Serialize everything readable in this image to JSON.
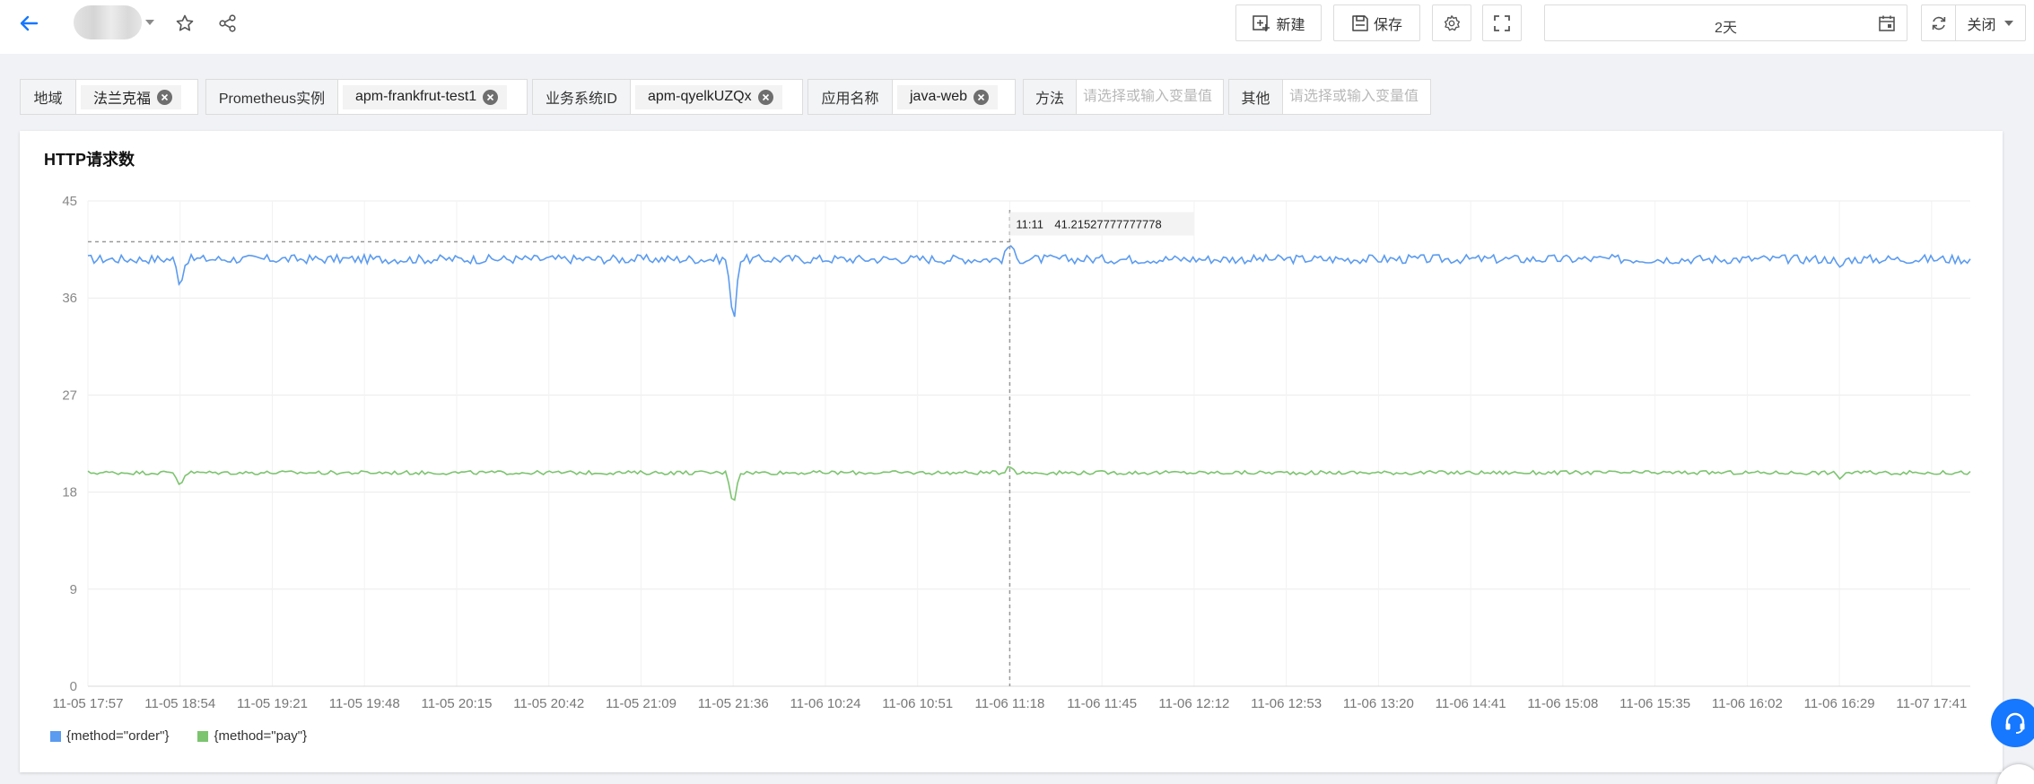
{
  "toolbar": {
    "new_label": "新建",
    "save_label": "保存",
    "time_range": "2天",
    "refresh_label": "关闭"
  },
  "filters": [
    {
      "label": "地域",
      "value": "法兰克福"
    },
    {
      "label": "Prometheus实例",
      "value": "apm-frankfrut-test1"
    },
    {
      "label": "业务系统ID",
      "value": "apm-qyelkUZQx"
    },
    {
      "label": "应用名称",
      "value": "java-web"
    },
    {
      "label": "方法",
      "placeholder": "请选择或输入变量值"
    },
    {
      "label": "其他",
      "placeholder": "请选择或输入变量值"
    }
  ],
  "panel": {
    "title": "HTTP请求数"
  },
  "tooltip": {
    "time": "11:11",
    "value": "41.21527777777778"
  },
  "chart_data": {
    "type": "line",
    "title": "HTTP请求数",
    "ylim": [
      0,
      45
    ],
    "yticks": [
      0,
      9,
      18,
      27,
      36,
      45
    ],
    "x": [
      "11-05 17:57",
      "11-05 18:54",
      "11-05 19:21",
      "11-05 19:48",
      "11-05 20:15",
      "11-05 20:42",
      "11-05 21:09",
      "11-05 21:36",
      "11-06 10:24",
      "11-06 10:51",
      "11-06 11:18",
      "11-06 11:45",
      "11-06 12:12",
      "11-06 12:53",
      "11-06 13:20",
      "11-06 14:41",
      "11-06 15:08",
      "11-06 15:35",
      "11-06 16:02",
      "11-06 16:29",
      "11-07 17:41"
    ],
    "grid": true,
    "legend_position": "bottom-left",
    "series": [
      {
        "name": "{method=\"order\"}",
        "color": "#5b9bf0",
        "baseline": 39.6,
        "events": [
          {
            "x": "11-05 18:54",
            "value": 37.2
          },
          {
            "x": "11-05 21:36",
            "value": 33.2
          },
          {
            "x": "11-06 11:18",
            "value": 41.2
          },
          {
            "x": "11-06 16:29",
            "value": 38.6
          }
        ]
      },
      {
        "name": "{method=\"pay\"}",
        "color": "#7cc46f",
        "baseline": 19.8,
        "events": [
          {
            "x": "11-05 18:54",
            "value": 18.6
          },
          {
            "x": "11-05 21:36",
            "value": 16.7
          },
          {
            "x": "11-06 11:18",
            "value": 20.6
          },
          {
            "x": "11-06 16:29",
            "value": 19.3
          }
        ]
      }
    ]
  }
}
